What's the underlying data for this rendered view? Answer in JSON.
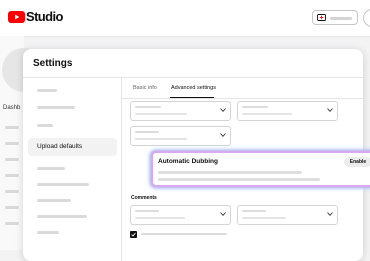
{
  "app": {
    "logo_text": "Studio"
  },
  "background": {
    "sidebar_visible_label": "Dashb"
  },
  "dialog": {
    "title": "Settings",
    "nav": {
      "selected_label": "Upload defaults"
    },
    "tabs": [
      {
        "label": "Basic info",
        "active": false
      },
      {
        "label": "Advanced settings",
        "active": true
      }
    ],
    "auto_dubbing": {
      "title": "Automatic Dubbing",
      "button_label": "Enable"
    },
    "comments_label": "Comments",
    "checkbox_checked": true
  },
  "colors": {
    "brand_red": "#ff0000",
    "card_glow_purple": "#d7a9ee",
    "card_glow_blue": "#a0c8fa"
  },
  "icons": [
    "youtube-logo-icon",
    "create-video-icon",
    "chevron-down-icon",
    "checkmark-icon"
  ]
}
